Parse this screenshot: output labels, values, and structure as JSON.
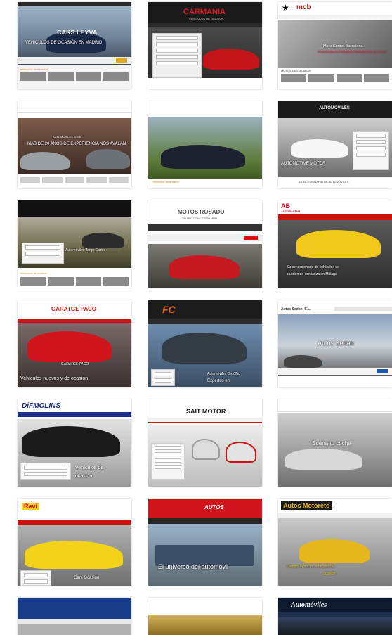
{
  "tiles": [
    {
      "brand": "CARS LEYVA",
      "caption": "VEHICULOS DE OCASIÓN EN MADRID",
      "strip": "Vehículos destacados"
    },
    {
      "brand": "CARMANIA",
      "sub": "VEHÍCULOS DE OCASIÓN"
    },
    {
      "brand": "mcb",
      "caption": "Moto Center Barcelona",
      "caption2": "Profesionales en mecánica y mantenimiento de tu moto",
      "strip": "MOTOS DESTACADAS"
    },
    {
      "caption": "AUTOMÓVILES JOSE",
      "caption2": "MÁS DE 20 AÑOS DE EXPERIENCIA NOS AVALAN"
    },
    {
      "caption": "Vehículos de ocasión"
    },
    {
      "brand": "AUTOMÓVILES",
      "caption": "AUTOMOTIVE MOTOR",
      "footer": "CONCESIONARIO DE AUTOMÓVILES"
    },
    {
      "caption": "Automóviles Jorge Castro",
      "strip": "Vehículos de ocasión"
    },
    {
      "brand": "MOTOS ROSADO",
      "sub": "CENTRO CONCESIONARIO"
    },
    {
      "brand": "AB",
      "brand2": "AUTOBALTAR",
      "caption": "Su concesionario de vehículos de",
      "caption2": "ocasión de confianza en Málaga"
    },
    {
      "brand": "GARATGE PACO",
      "caption": "GARATGE PACO",
      "caption2": "Vehículos nuevos y de ocasión"
    },
    {
      "brand": "FC",
      "caption": "Automóviles Ordóñez",
      "caption2": "Expertos en"
    },
    {
      "brand": "Autos Sedan, S.L.",
      "caption": "Autos Sedán"
    },
    {
      "brand": "DiFMOLINS",
      "caption": "Vehículos de",
      "caption2": "ocasión"
    },
    {
      "brand": "SAIT MOTOR"
    },
    {
      "caption": "Suena tu coche"
    },
    {
      "brand": "Ravi",
      "caption": "Cars Ocasión"
    },
    {
      "brand": "AUTOS",
      "caption": "El universo del automóvil"
    },
    {
      "brand": "Autos Motoreto",
      "caption": "Compra venta de vehículos de",
      "caption2": "ocasión"
    },
    {},
    {},
    {
      "brand": "Automóviles"
    }
  ]
}
